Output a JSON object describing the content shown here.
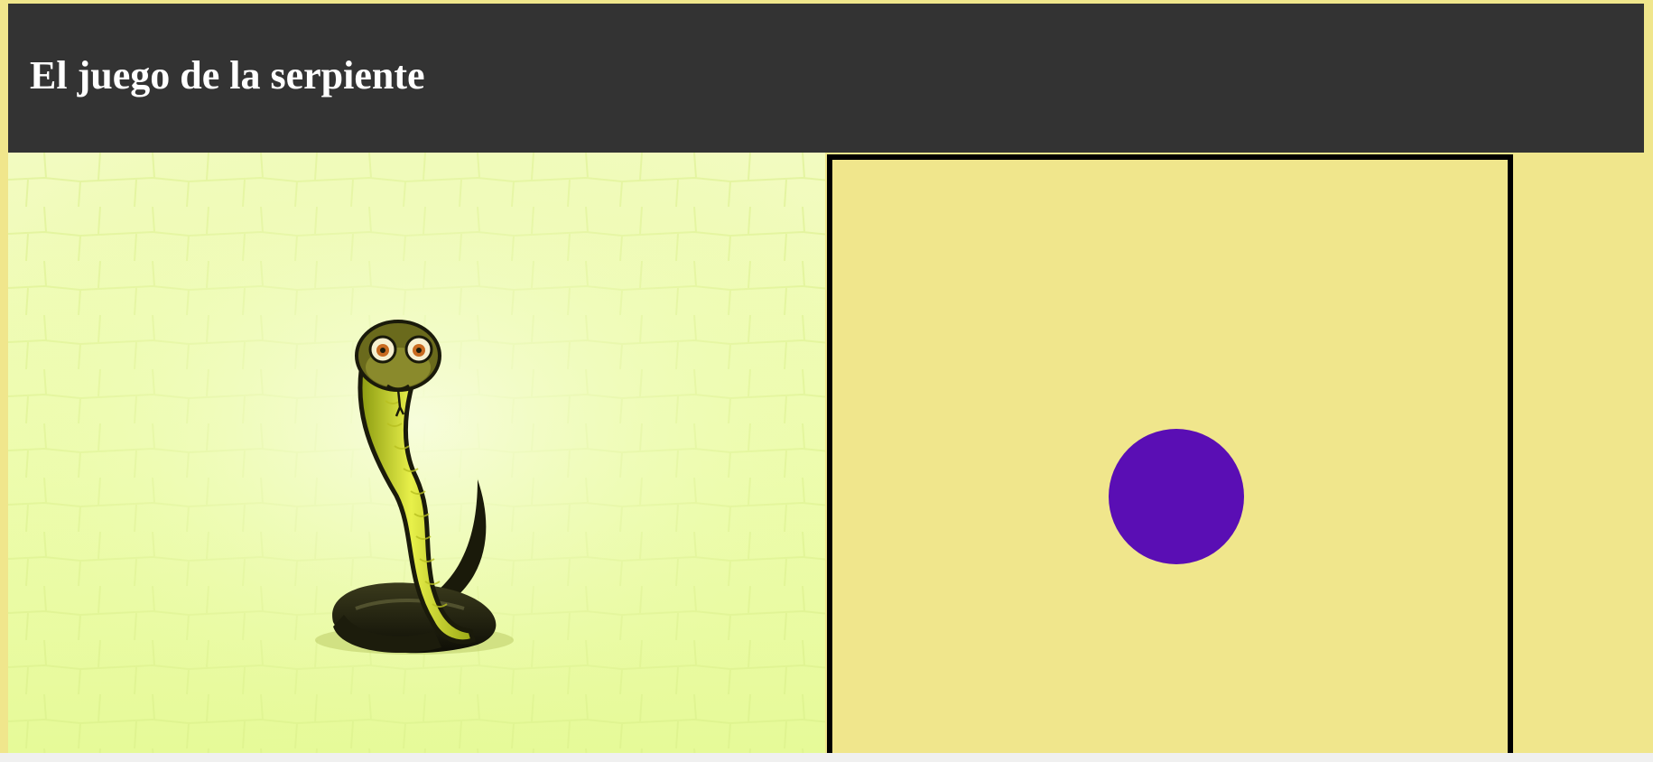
{
  "header": {
    "title": "El juego de la serpiente"
  },
  "illustration": {
    "icon": "snake-cobra-illustration"
  },
  "board": {
    "food_color": "#5a0eb4",
    "background_color": "#f0e68c",
    "border_color": "#000000"
  },
  "colors": {
    "page_background": "#f0e68c",
    "header_background": "#333333",
    "title_text": "#ffffff"
  }
}
